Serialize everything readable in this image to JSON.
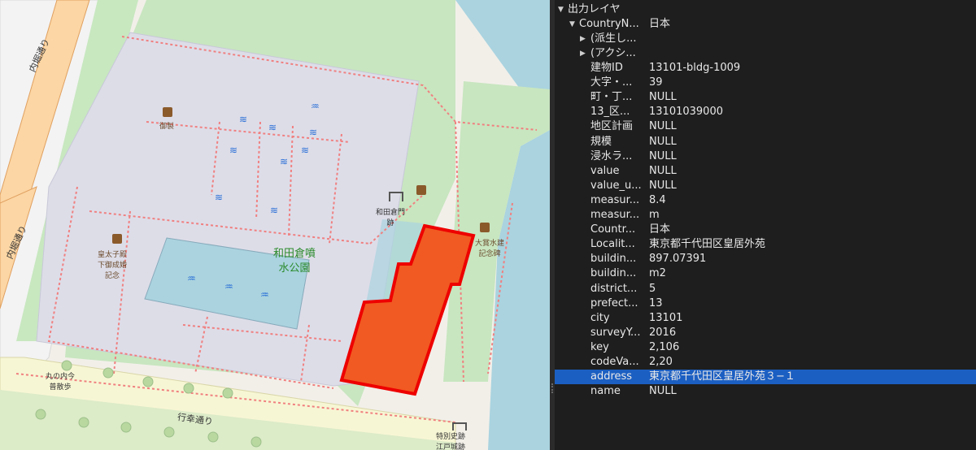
{
  "map": {
    "labels": {
      "road_uchibori_top": "内堀通り",
      "road_uchibori_left": "内堀通り",
      "road_gyoko": "行幸通り",
      "poi_gosei": "御製",
      "poi_kotaishi": "皇太子殿\n下御成婚\n記念",
      "park": "和田倉噴\n水公園",
      "gate": "和田倉門\n跡",
      "poi_kaiten": "大賞水建\n記念碑",
      "poi_marunouchi": "丸の内今\n普散歩",
      "poi_shiseki": "特別史跡\n江戸城跡"
    },
    "highlight_color": "#f15a22",
    "highlight_stroke": "#ee0000"
  },
  "tree": {
    "root": "出力レイヤ",
    "country_key": "CountryN...",
    "country_value": "日本",
    "sub1": "(派生し...",
    "sub2": "(アクシ...",
    "attributes": [
      {
        "k": "建物ID",
        "v": "13101-bldg-1009"
      },
      {
        "k": "大字・...",
        "v": "39"
      },
      {
        "k": "町・丁...",
        "v": "NULL"
      },
      {
        "k": "13_区...",
        "v": "13101039000"
      },
      {
        "k": "地区計画",
        "v": "NULL"
      },
      {
        "k": "規模",
        "v": "NULL"
      },
      {
        "k": "浸水ラ...",
        "v": "NULL"
      },
      {
        "k": "value",
        "v": "NULL"
      },
      {
        "k": "value_u...",
        "v": "NULL"
      },
      {
        "k": "measur...",
        "v": "8.4"
      },
      {
        "k": "measur...",
        "v": "m"
      },
      {
        "k": "Countr...",
        "v": "日本"
      },
      {
        "k": "Localit...",
        "v": "東京都千代田区皇居外苑"
      },
      {
        "k": "buildin...",
        "v": "897.07391"
      },
      {
        "k": "buildin...",
        "v": "m2"
      },
      {
        "k": "district...",
        "v": "5"
      },
      {
        "k": "prefect...",
        "v": "13"
      },
      {
        "k": "city",
        "v": "13101"
      },
      {
        "k": "surveyY...",
        "v": "2016"
      },
      {
        "k": "key",
        "v": "2,106"
      },
      {
        "k": "codeVa...",
        "v": "2,20"
      },
      {
        "k": "address",
        "v": "東京都千代田区皇居外苑３−１"
      },
      {
        "k": "name",
        "v": "NULL"
      }
    ],
    "selected_key": "address"
  }
}
